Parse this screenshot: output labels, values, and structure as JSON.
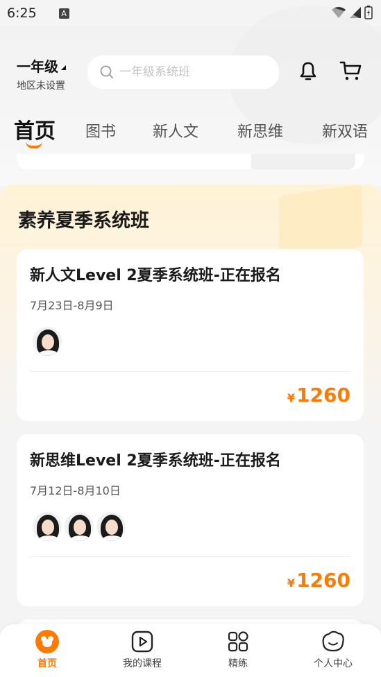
{
  "status_bar": {
    "time": "6:25",
    "notification_badge": "A"
  },
  "header": {
    "grade": "一年级",
    "region": "地区未设置",
    "search_placeholder": "一年级系统班"
  },
  "tabs": [
    {
      "label": "首页",
      "active": true
    },
    {
      "label": "图书",
      "active": false
    },
    {
      "label": "新人文",
      "active": false
    },
    {
      "label": "新思维",
      "active": false
    },
    {
      "label": "新双语",
      "active": false
    }
  ],
  "section": {
    "title": "素养夏季系统班",
    "courses": [
      {
        "title": "新人文Level 2夏季系统班-正在报名",
        "date": "7月23日-8月9日",
        "teacher_count": 1,
        "currency": "¥",
        "price": "1260"
      },
      {
        "title": "新思维Level 2夏季系统班-正在报名",
        "date": "7月12日-8月10日",
        "teacher_count": 3,
        "currency": "¥",
        "price": "1260"
      }
    ]
  },
  "bottom_nav": [
    {
      "label": "首页",
      "icon": "home-icon",
      "active": true
    },
    {
      "label": "我的课程",
      "icon": "play-icon",
      "active": false
    },
    {
      "label": "精练",
      "icon": "grid-icon",
      "active": false
    },
    {
      "label": "个人中心",
      "icon": "profile-icon",
      "active": false
    }
  ],
  "colors": {
    "accent": "#ff7a00",
    "background": "#f4f4f4"
  }
}
